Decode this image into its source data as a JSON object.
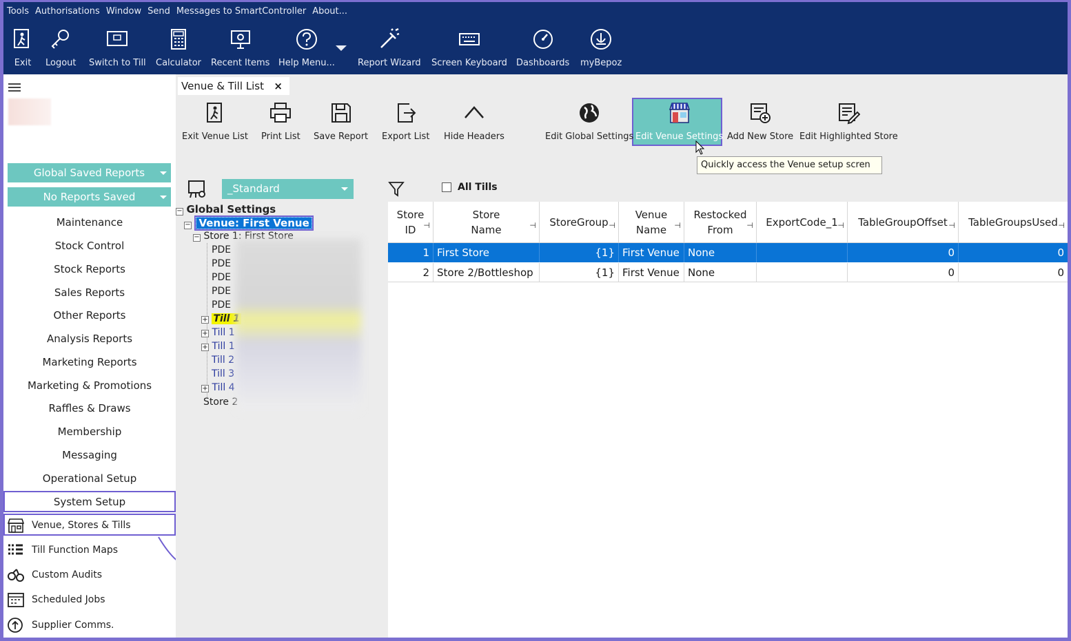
{
  "menu": [
    "Tools",
    "Authorisations",
    "Window",
    "Send",
    "Messages to SmartController",
    "About..."
  ],
  "toolbar": [
    {
      "label": "Exit",
      "icon": "exit-icon"
    },
    {
      "label": "Logout",
      "icon": "key-icon"
    },
    {
      "label": "Switch to Till",
      "icon": "till-icon"
    },
    {
      "label": "Calculator",
      "icon": "calculator-icon"
    },
    {
      "label": "Recent Items",
      "icon": "recent-icon"
    },
    {
      "label": "Help Menu...",
      "icon": "help-icon"
    },
    {
      "label": "Report Wizard",
      "icon": "wand-icon"
    },
    {
      "label": "Screen Keyboard",
      "icon": "keyboard-icon"
    },
    {
      "label": "Dashboards",
      "icon": "gauge-icon"
    },
    {
      "label": "myBepoz",
      "icon": "mybepoz-icon"
    }
  ],
  "sidebar": {
    "global_saved_reports": "Global Saved Reports",
    "no_reports_saved": "No Reports Saved",
    "items": [
      "Maintenance",
      "Stock Control",
      "Stock Reports",
      "Sales Reports",
      "Other Reports",
      "Analysis Reports",
      "Marketing Reports",
      "Marketing & Promotions",
      "Raffles & Draws",
      "Membership",
      "Messaging",
      "Operational Setup",
      "System Setup"
    ],
    "sub_items": [
      "Venue, Stores & Tills",
      "Till Function Maps",
      "Custom Audits",
      "Scheduled Jobs",
      "Supplier Comms."
    ]
  },
  "tab": {
    "title": "Venue & Till List",
    "close": "×"
  },
  "actions": [
    "Exit Venue List",
    "Print List",
    "Save Report",
    "Export List",
    "Hide Headers",
    "Edit Global Settings",
    "Edit Venue Settings",
    "Add New Store",
    "Edit Highlighted Store"
  ],
  "tooltip": "Quickly access the Venue setup scren",
  "view_select": "_Standard",
  "all_tills_label": "All Tills",
  "tree": {
    "global": "Global Settings",
    "venue": "Venue: First Venue",
    "store1": "Store 1: First Store",
    "pde": [
      "PDE",
      "PDE",
      "PDE",
      "PDE",
      "PDE"
    ],
    "tills": [
      "Till 1",
      "Till 1",
      "Till 1",
      "Till 2",
      "Till 3",
      "Till 4"
    ],
    "store2": "Store 2"
  },
  "table": {
    "columns": [
      "Store ID",
      "Store Name",
      "StoreGroup",
      "Venue Name",
      "Restocked From",
      "ExportCode_1",
      "TableGroupOffset",
      "TableGroupsUsed"
    ],
    "rows": [
      [
        "1",
        "First Store",
        "{1}",
        "First Venue",
        "None",
        "",
        "0",
        "0"
      ],
      [
        "2",
        "Store 2/Bottleshop",
        "{1}",
        "First Venue",
        "None",
        "",
        "0",
        "0"
      ]
    ]
  }
}
